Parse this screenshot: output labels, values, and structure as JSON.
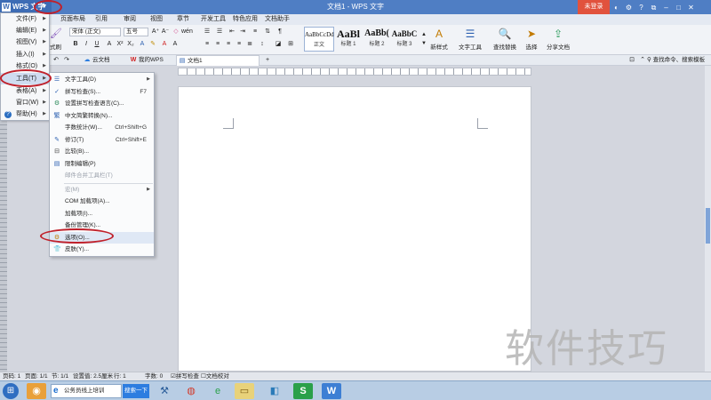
{
  "titlebar": {
    "app_name": "WPS 文字",
    "window_title": "文档1 - WPS 文字",
    "login_label": "未登录",
    "icons": [
      "skin-icon",
      "settings-icon",
      "help-icon",
      "restore-icon",
      "minimize-icon",
      "maximize-icon",
      "close-icon"
    ]
  },
  "menu_tabs": [
    "页面布局",
    "引用",
    "审阅",
    "视图",
    "章节",
    "开发工具",
    "特色应用",
    "文档助手"
  ],
  "ribbon": {
    "painter_label": "式刷",
    "font_name": "宋体 (正文)",
    "font_size": "五号",
    "styles": [
      {
        "sample": "AaBbCcDd",
        "label": "正文"
      },
      {
        "sample": "AaBl",
        "label": "标题 1"
      },
      {
        "sample": "AaBb(",
        "label": "标题 2"
      },
      {
        "sample": "AaBbC",
        "label": "标题 3"
      }
    ],
    "new_style_label": "新样式",
    "text_tools_label": "文字工具",
    "find_replace_label": "查找替换",
    "select_label": "选择",
    "share_label": "分享文档"
  },
  "doc_tabs": [
    {
      "label": "云文档",
      "icon": "cloud-icon"
    },
    {
      "label": "我的WPS",
      "icon": "wps-icon"
    },
    {
      "label": "文档1",
      "icon": "doc-icon"
    }
  ],
  "command_search": "查找命令、搜索模板",
  "main_menu": [
    {
      "label": "文件(F)",
      "icon": "",
      "has_sub": true
    },
    {
      "label": "编辑(E)",
      "icon": "",
      "has_sub": true
    },
    {
      "label": "视图(V)",
      "icon": "",
      "has_sub": true
    },
    {
      "label": "插入(I)",
      "icon": "",
      "has_sub": true
    },
    {
      "label": "格式(O)",
      "icon": "",
      "has_sub": true
    },
    {
      "label": "工具(T)",
      "icon": "",
      "has_sub": true,
      "selected": true
    },
    {
      "label": "表格(A)",
      "icon": "",
      "has_sub": true
    },
    {
      "label": "窗口(W)",
      "icon": "",
      "has_sub": true
    },
    {
      "label": "帮助(H)",
      "icon": "help-icon",
      "has_sub": true
    }
  ],
  "tools_menu": [
    {
      "label": "文字工具(D)",
      "icon": "text-tools-icon",
      "arrow": true
    },
    {
      "label": "拼写检查(S)...",
      "shortcut": "F7",
      "icon": "spellcheck-icon"
    },
    {
      "label": "设置拼写检查语言(C)...",
      "icon": "language-icon"
    },
    {
      "label": "中文简繁转换(N)...",
      "icon": "convert-icon"
    },
    {
      "label": "字数统计(W)...",
      "shortcut": "Ctrl+Shift+G"
    },
    {
      "label": "修订(T)",
      "shortcut": "Ctrl+Shift+E",
      "icon": "revise-icon"
    },
    {
      "label": "比较(B)...",
      "icon": "compare-icon"
    },
    {
      "label": "限制编辑(P)",
      "icon": "restrict-icon"
    },
    {
      "label": "邮件合并工具栏(T)",
      "disabled": true
    },
    {
      "label": "宏(M)",
      "disabled": true,
      "arrow": true
    },
    {
      "label": "COM 加载项(A)..."
    },
    {
      "label": "加载项(I)..."
    },
    {
      "label": "备份管理(K)..."
    },
    {
      "label": "选项(O)...",
      "icon": "options-icon",
      "selected": true
    },
    {
      "label": "皮肤(Y)...",
      "icon": "skin-icon"
    }
  ],
  "statusbar": {
    "page_no": "页码: 1",
    "pages": "页面: 1/1",
    "section": "节: 1/1",
    "setting": "设置值: 2.5厘米",
    "row": "行: 1",
    "words": "字数: 0",
    "spell": "拼写检查",
    "doc_check": "文档校对"
  },
  "taskbar": {
    "ie_text": "公务员线上培训",
    "search_label": "搜索一下"
  },
  "watermark": "软件技巧"
}
